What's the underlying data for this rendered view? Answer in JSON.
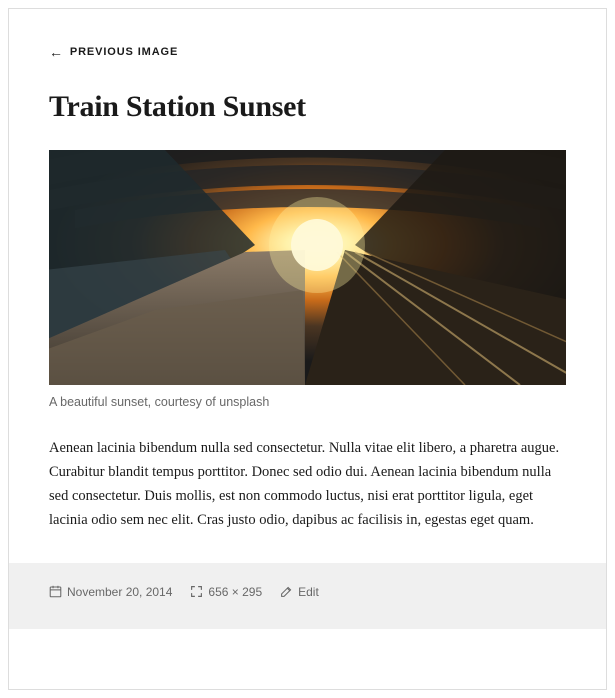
{
  "nav": {
    "prev_label": "PREVIOUS IMAGE"
  },
  "post": {
    "title": "Train Station Sunset",
    "caption": "A beautiful sunset, courtesy of unsplash",
    "body": "Aenean lacinia bibendum nulla sed consectetur. Nulla vitae elit libero, a pharetra augue. Curabitur blandit tempus porttitor. Donec sed odio dui. Aenean lacinia bibendum nulla sed consectetur. Duis mollis, est non commodo luctus, nisi erat porttitor ligula, eget lacinia odio sem nec elit. Cras justo odio, dapibus ac facilisis in, egestas eget quam."
  },
  "meta": {
    "date": "November 20, 2014",
    "dimensions": "656 × 295",
    "edit_label": "Edit"
  }
}
